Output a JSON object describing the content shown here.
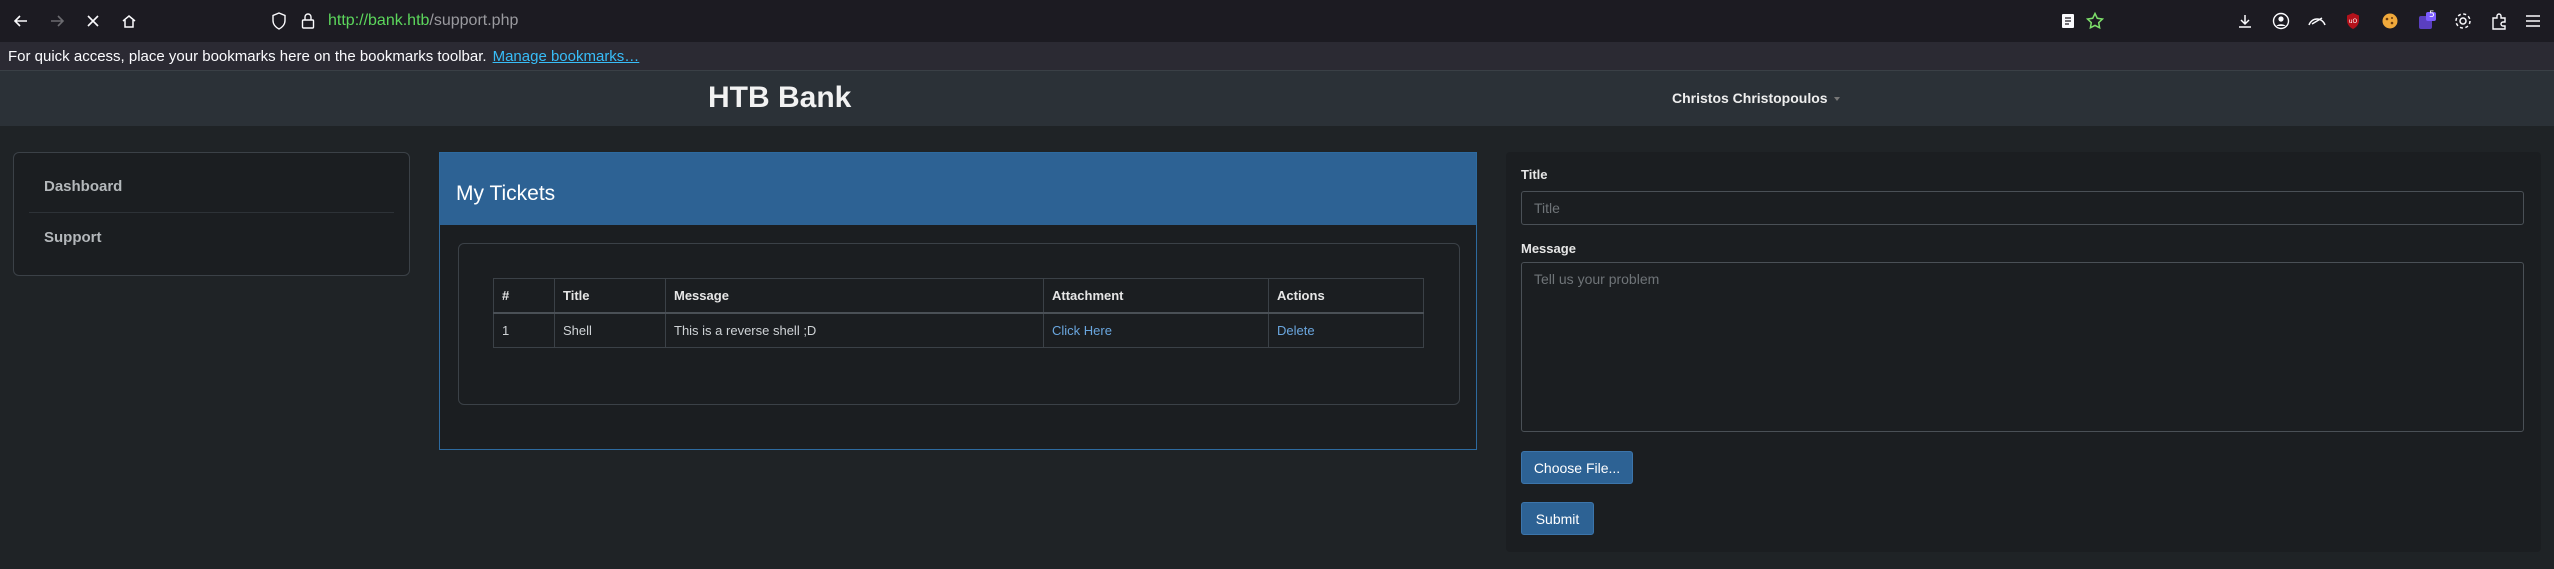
{
  "browser": {
    "url_host": "http://bank.htb",
    "url_path": "/support.php",
    "icons": [
      "back-icon",
      "forward-icon",
      "stop-icon",
      "home-icon",
      "shield-icon",
      "lock-icon",
      "reader-mode-icon",
      "bookmark-star-icon",
      "downloads-icon",
      "account-icon",
      "extension-icon",
      "ublock-icon",
      "cookie-icon",
      "extension-badge-icon",
      "settings-icon",
      "extensions-puzzle-icon",
      "menu-icon"
    ],
    "extension_badge": "5",
    "bookmarks_text": "For quick access, place your bookmarks here on the bookmarks toolbar.",
    "bookmarks_link": "Manage bookmarks…"
  },
  "app": {
    "brand": "HTB Bank",
    "user": "Christos Christopoulos"
  },
  "sidebar": {
    "items": [
      {
        "label": "Dashboard"
      },
      {
        "label": "Support"
      }
    ]
  },
  "tickets": {
    "title": "My Tickets",
    "columns": [
      "#",
      "Title",
      "Message",
      "Attachment",
      "Actions"
    ],
    "rows": [
      {
        "id": "1",
        "title": "Shell",
        "message": "This is a reverse shell ;D",
        "attachment": "Click Here",
        "action": "Delete"
      }
    ]
  },
  "form": {
    "title_label": "Title",
    "title_placeholder": "Title",
    "message_label": "Message",
    "message_placeholder": "Tell us your problem",
    "file_button": "Choose File...",
    "submit_button": "Submit"
  },
  "colors": {
    "accent": "#2d6294",
    "link": "#6aa6de",
    "url_green": "#5cd65c"
  }
}
